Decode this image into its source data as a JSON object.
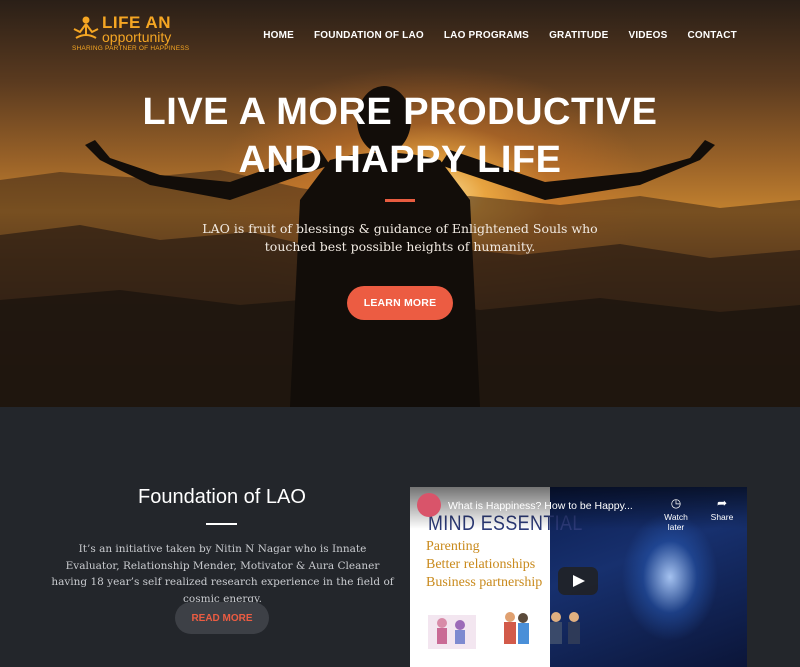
{
  "brand": {
    "line1": "LIFE AN",
    "line2": "opportunity",
    "tagline": "SHARING PARTNER OF HAPPINESS",
    "color": "#f5a623"
  },
  "nav": {
    "items": [
      {
        "label": "HOME"
      },
      {
        "label": "FOUNDATION OF LAO"
      },
      {
        "label": "LAO PROGRAMS"
      },
      {
        "label": "GRATITUDE"
      },
      {
        "label": "VIDEOS"
      },
      {
        "label": "CONTACT"
      }
    ]
  },
  "hero": {
    "title_line1": "LIVE A MORE PRODUCTIVE",
    "title_line2": "AND HAPPY LIFE",
    "subtitle": "LAO is fruit of blessings & guidance of Enlightened Souls who touched best possible heights of humanity.",
    "button_label": "LEARN MORE",
    "accent": "#ec5c42"
  },
  "foundation": {
    "title": "Foundation of LAO",
    "text": "It’s an initiative taken by Nitin N Nagar who is Innate Evaluator, Relationship Mender, Motivator & Aura Cleaner having 18 year’s self realized research experience in the field of cosmic energy.",
    "button_label": "READ MORE"
  },
  "video": {
    "title": "What is Happiness? How to be Happy...",
    "watch_later": "Watch later",
    "share": "Share",
    "heading": "MIND ESSENTIAL",
    "bullets": [
      "Parenting",
      "Better relationships",
      "Business partnership"
    ]
  }
}
